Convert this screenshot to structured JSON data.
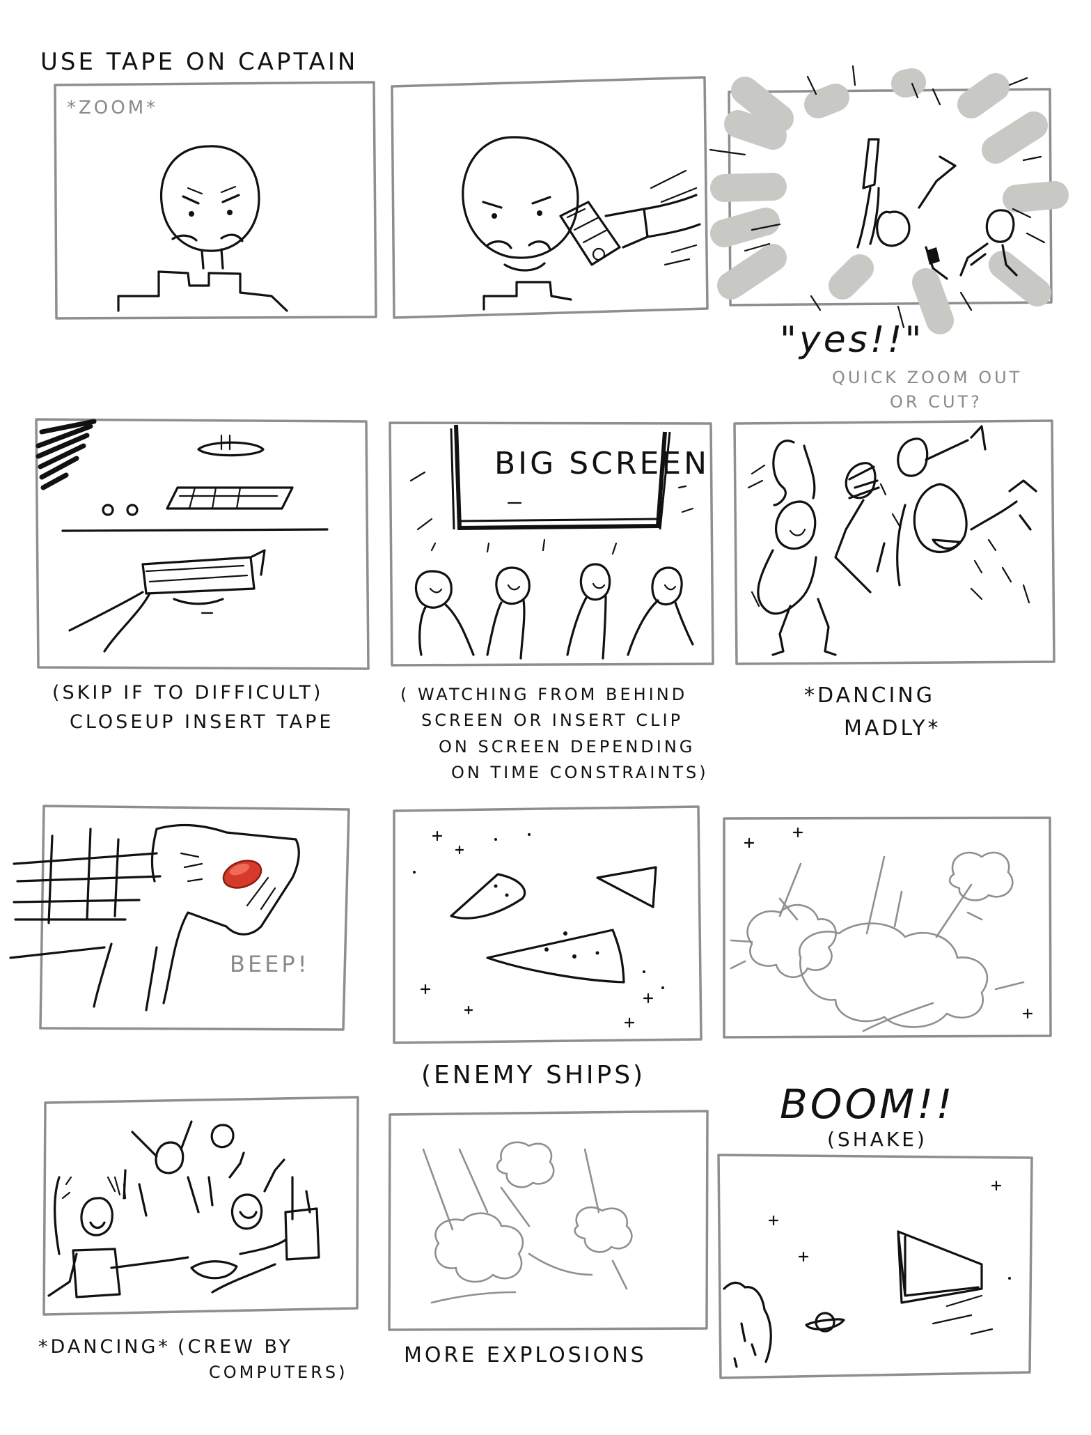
{
  "panel_1": {
    "heading": "USE TAPE ON CAPTAIN",
    "note": "*ZOOM*"
  },
  "panel_3": {
    "shout": "\"yes!!\"",
    "note_line1": "QUICK ZOOM OUT",
    "note_line2": "OR CUT?"
  },
  "panel_4": {
    "caption_line1": "(SKIP IF TO DIFFICULT)",
    "caption_line2": "CLOSEUP INSERT TAPE"
  },
  "panel_5": {
    "screen_label": "BIG SCREEN",
    "caption_line1": "( WATCHING FROM BEHIND",
    "caption_line2": "SCREEN OR INSERT CLIP",
    "caption_line3": "ON SCREEN DEPENDING",
    "caption_line4": "ON TIME CONSTRAINTS)"
  },
  "panel_6": {
    "caption_line1": "*DANCING",
    "caption_line2": "MADLY*"
  },
  "panel_7": {
    "sound": "BEEP!"
  },
  "panel_8": {
    "caption": "(ENEMY SHIPS)"
  },
  "panel_9": {
    "shout": "BOOM!!",
    "caption": "(SHAKE)"
  },
  "panel_10": {
    "caption_left": "*DANCING*",
    "caption_right_line1": "(CREW BY",
    "caption_right_line2": "COMPUTERS)"
  },
  "panel_11": {
    "caption": "MORE EXPLOSIONS"
  },
  "colors": {
    "frame": "#8e8e8e",
    "ink": "#111111",
    "pencil_grey": "#8f8f8f",
    "button_red": "#d63a2a"
  }
}
